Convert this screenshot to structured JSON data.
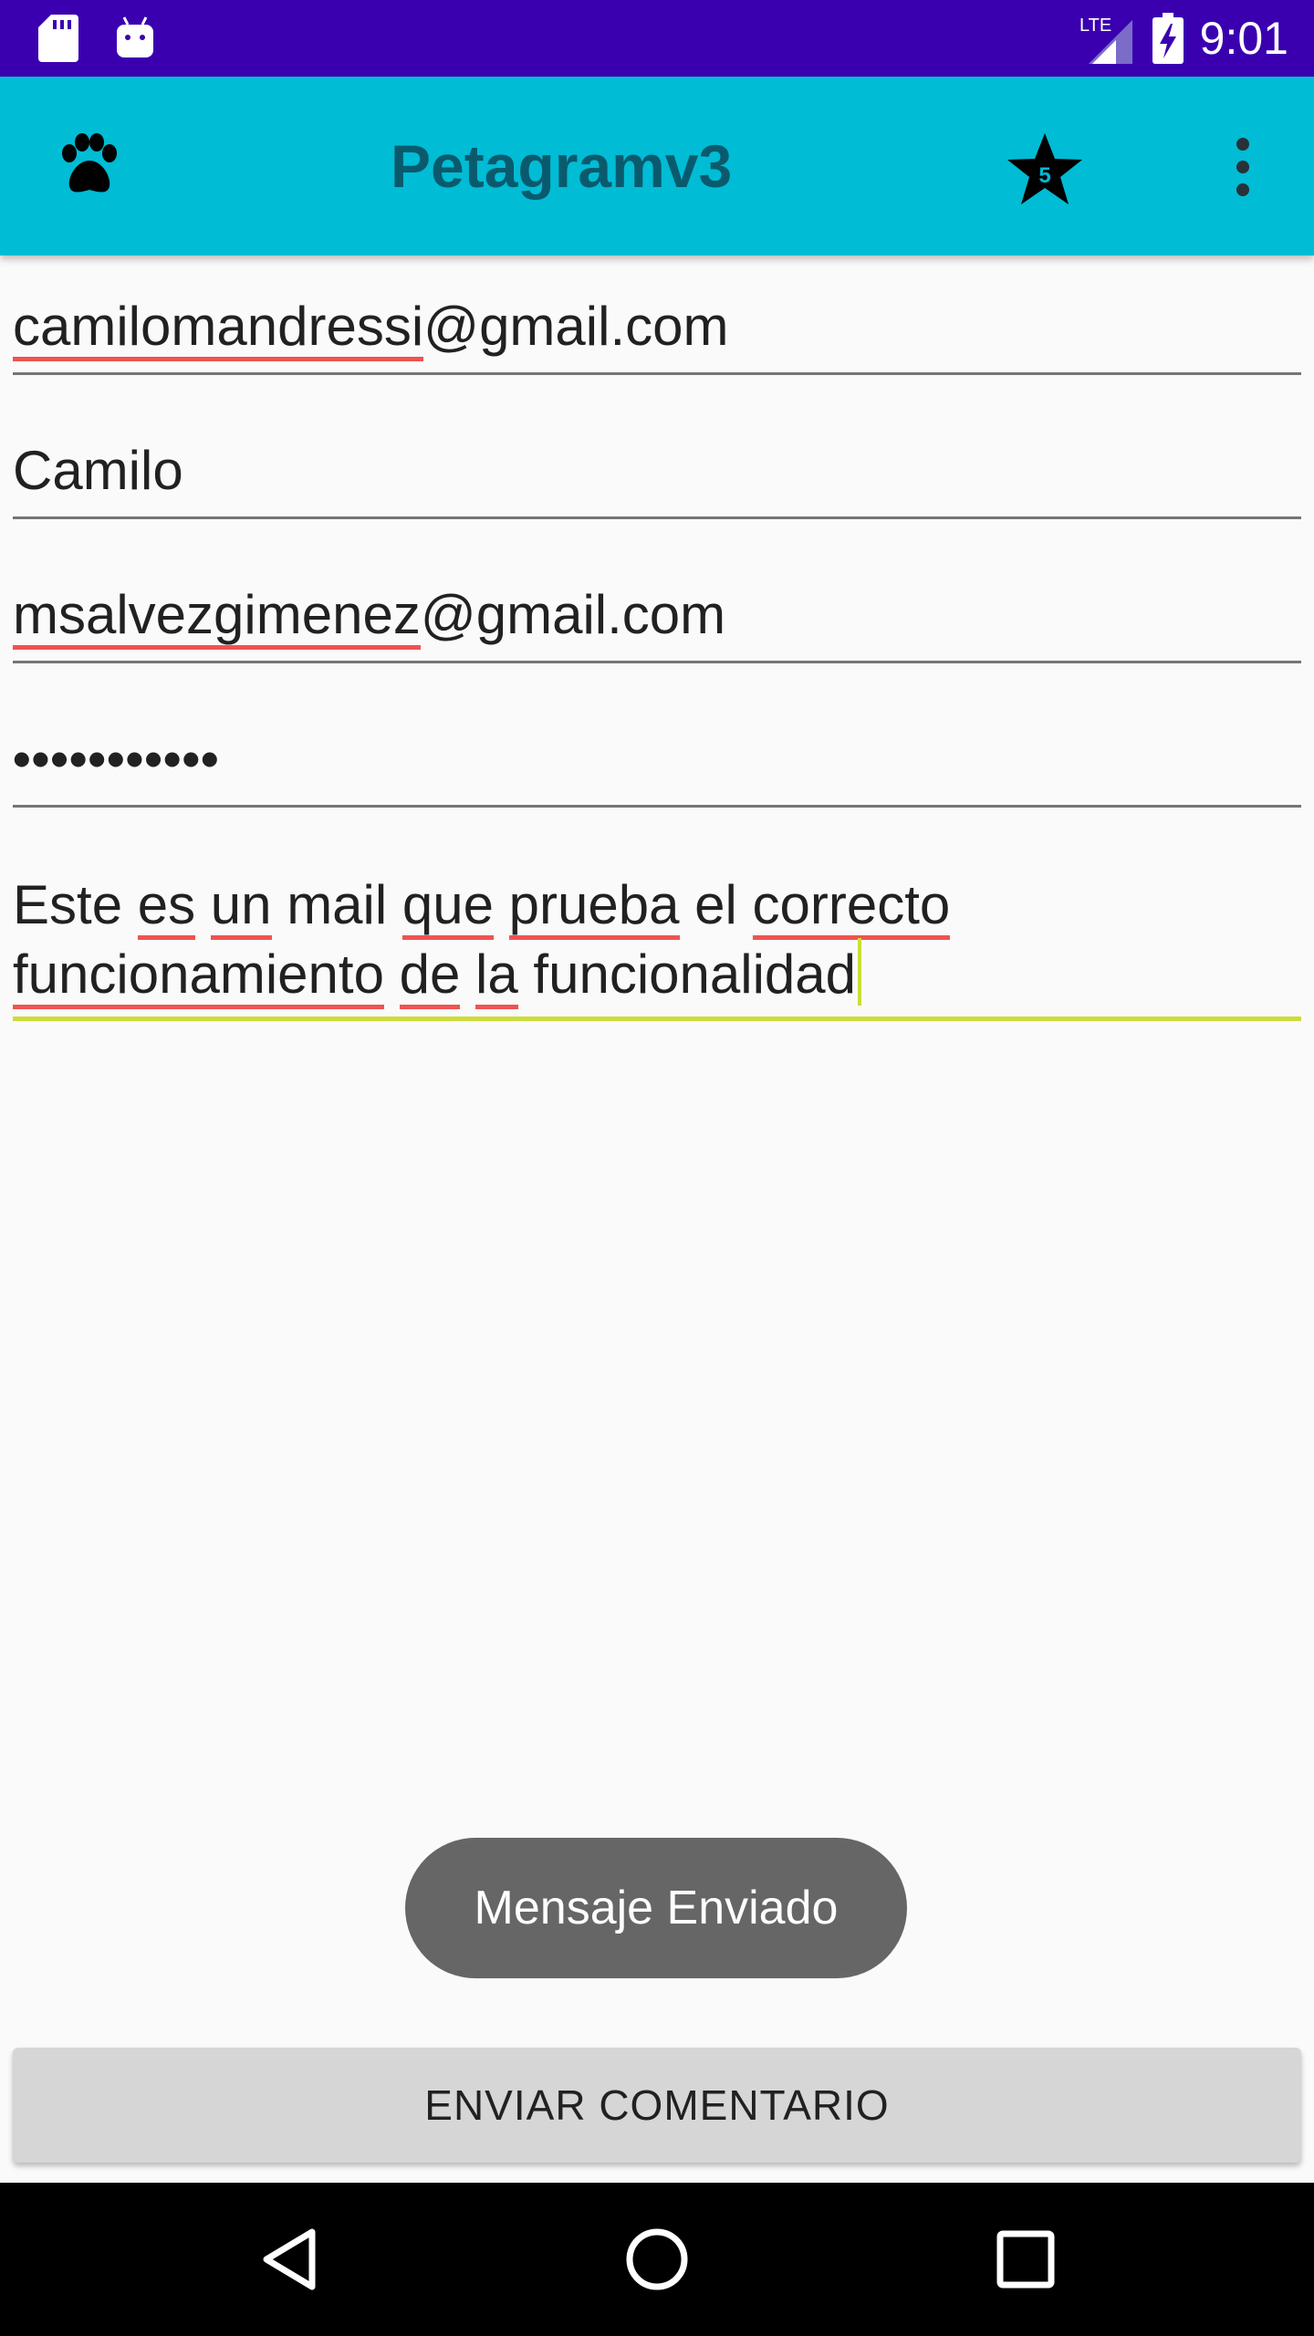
{
  "status_bar": {
    "time": "9:01",
    "network": "LTE",
    "icons": [
      "sd-card-icon",
      "android-icon",
      "signal-icon",
      "battery-charging-icon"
    ]
  },
  "app_bar": {
    "title": "Petagramv3",
    "star_badge": "5",
    "icons": [
      "paw-icon",
      "star-icon",
      "overflow-menu-icon"
    ],
    "background": "#00bcd4",
    "title_color": "#0a5a6e"
  },
  "form": {
    "sender_email": {
      "misspelled": "camilomandressi",
      "rest": "@gmail.com"
    },
    "name": "Camilo",
    "recipient_email": {
      "misspelled": "msalvezgimenez",
      "rest": "@gmail.com"
    },
    "password_mask": "•••••••••••",
    "message": {
      "line1": [
        "Este ",
        "es",
        " ",
        "un",
        " mail ",
        "que",
        " ",
        "prueba",
        " el ",
        "correcto"
      ],
      "line2": [
        "funcionamiento",
        " ",
        "de",
        " ",
        "la",
        " funcionalidad"
      ]
    },
    "focus_color": "#cddc39"
  },
  "toast": {
    "text": "Mensaje Enviado"
  },
  "send_button": {
    "label": "ENVIAR COMENTARIO"
  },
  "nav_bar": {
    "icons": [
      "back-icon",
      "home-icon",
      "recents-icon"
    ]
  }
}
